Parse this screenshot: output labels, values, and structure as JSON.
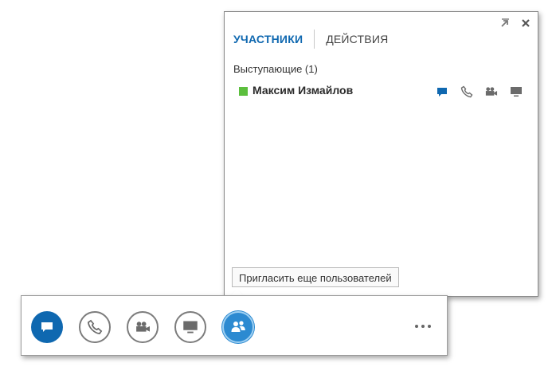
{
  "panel": {
    "tabs": [
      {
        "label": "УЧАСТНИКИ",
        "active": true
      },
      {
        "label": "ДЕЙСТВИЯ",
        "active": false
      }
    ],
    "group_title": "Выступающие (1)",
    "participant": {
      "name": "Максим Измайлов",
      "presence_color": "#5cbf3e",
      "icons": [
        "im-icon",
        "phone-icon",
        "video-icon",
        "screen-share-icon"
      ]
    },
    "invite_label": "Пригласить еще пользователей",
    "popout_icon": "popout-icon",
    "close_icon": "close-icon"
  },
  "toolbar": {
    "buttons": [
      "im-button",
      "call-button",
      "video-button",
      "present-button",
      "participants-button"
    ],
    "accent_color": "#0f68b0",
    "more_icon": "more-options-icon"
  }
}
